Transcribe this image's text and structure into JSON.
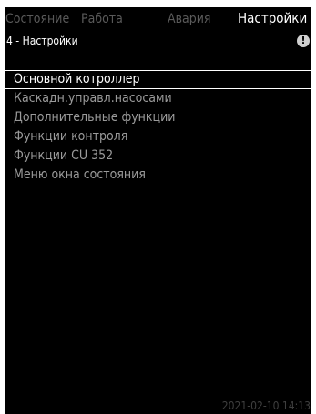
{
  "tabs": [
    {
      "label": "Состояние"
    },
    {
      "label": "Работа"
    },
    {
      "label": "Авария"
    },
    {
      "label": "Настройки"
    }
  ],
  "active_tab": "Настройки",
  "subheader": {
    "title": "4 - Настройки",
    "info_icon": "!"
  },
  "menu": {
    "items": [
      {
        "label": "Основной котроллер"
      },
      {
        "label": "Каскадн.управл.насосами"
      },
      {
        "label": "Дополнительные функции"
      },
      {
        "label": "Функции контроля"
      },
      {
        "label": "Функции CU 352"
      },
      {
        "label": "Меню окна состояния"
      }
    ],
    "selected_label": "Основной котроллер"
  },
  "status": {
    "datetime": "2021-02-10 14:13"
  },
  "colors": {
    "background": "#000000",
    "active_text": "#ffffff",
    "inactive_text": "#5a5a5a",
    "menu_text": "#9a9a9a"
  }
}
